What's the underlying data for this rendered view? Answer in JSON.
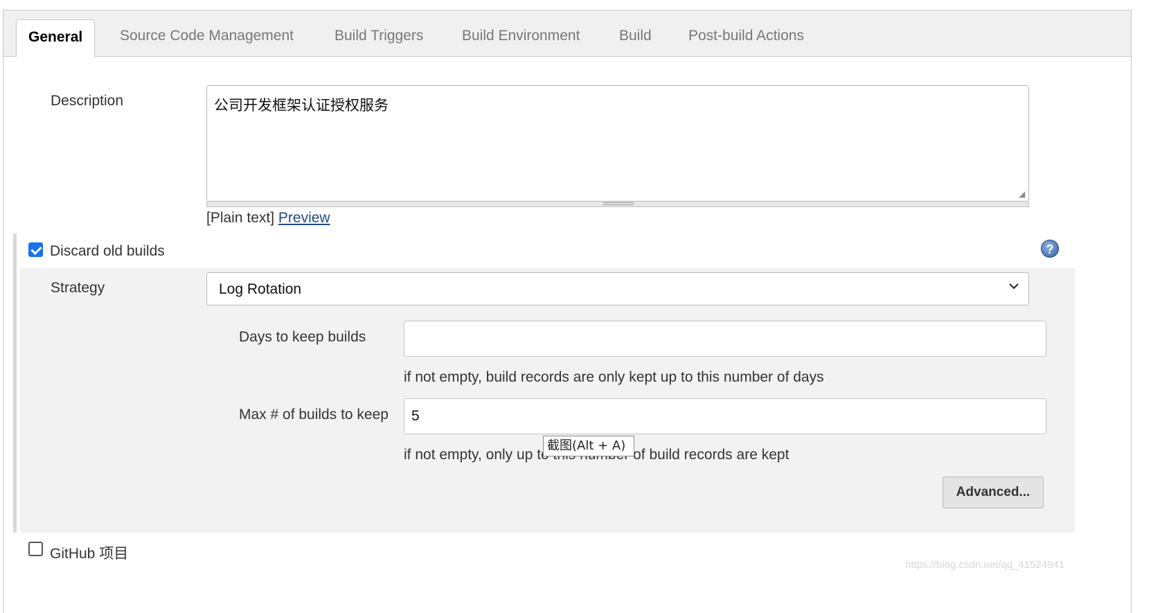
{
  "tabs": [
    {
      "label": "General",
      "active": true
    },
    {
      "label": "Source Code Management",
      "active": false
    },
    {
      "label": "Build Triggers",
      "active": false
    },
    {
      "label": "Build Environment",
      "active": false
    },
    {
      "label": "Build",
      "active": false
    },
    {
      "label": "Post-build Actions",
      "active": false
    }
  ],
  "description": {
    "label": "Description",
    "value": "公司开发框架认证授权服务",
    "format_text": "[Plain text]",
    "preview_link": "Preview"
  },
  "discard_old_builds": {
    "checked": true,
    "label": "Discard old builds",
    "help_icon": "question-circle-icon",
    "strategy": {
      "label": "Strategy",
      "selected": "Log Rotation"
    },
    "days_to_keep": {
      "label": "Days to keep builds",
      "value": "",
      "hint": "if not empty, build records are only kept up to this number of days"
    },
    "max_builds": {
      "label": "Max # of builds to keep",
      "value": "5",
      "hint": "if not empty, only up to this number of build records are kept"
    },
    "advanced_button": "Advanced..."
  },
  "github_project": {
    "checked": false,
    "label": "GitHub 项目"
  },
  "tooltip": "截图(Alt + A)",
  "watermark": "https://blog.csdn.net/qq_41524941",
  "colors": {
    "checkbox_accent": "#1a73e8",
    "link": "#204a87",
    "section_bg": "#f2f2f2",
    "tabbar_bg": "#f0f0f0"
  }
}
